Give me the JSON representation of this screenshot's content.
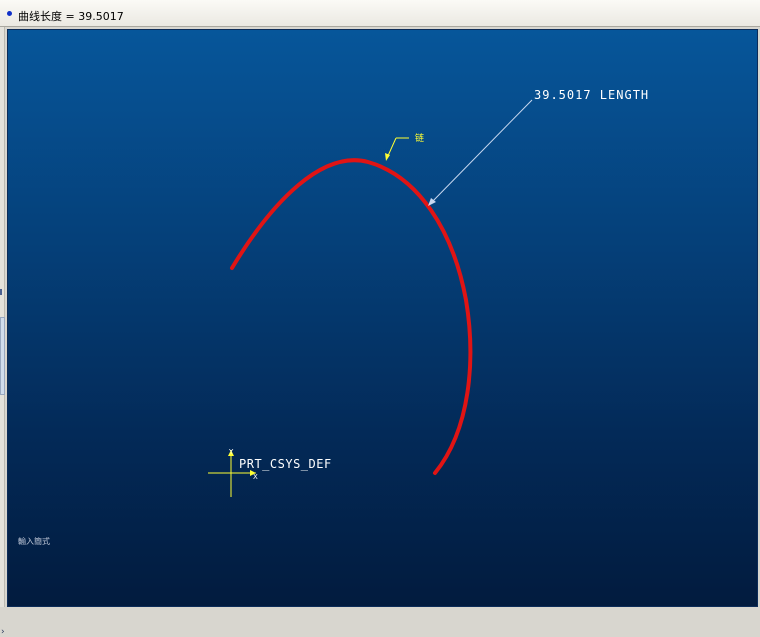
{
  "message_bar": {
    "text": "曲线长度 = 39.5017"
  },
  "viewport": {
    "background_top": "#06569a",
    "background_bottom": "#021b3e",
    "curve_color": "#e01414",
    "annotation_color": "#ffff33",
    "leader_color": "#c8d8f0",
    "annotations": {
      "length_note": "39.5017 LENGTH",
      "curve_tag": "链",
      "csys_label": "PRT_CSYS_DEF",
      "csys_x_axis": "X",
      "csys_y_axis": "Y",
      "status_hint": "輸入簡式"
    }
  },
  "side_panel": {
    "collapse_arrow_icon": "chevron-right-icon"
  }
}
